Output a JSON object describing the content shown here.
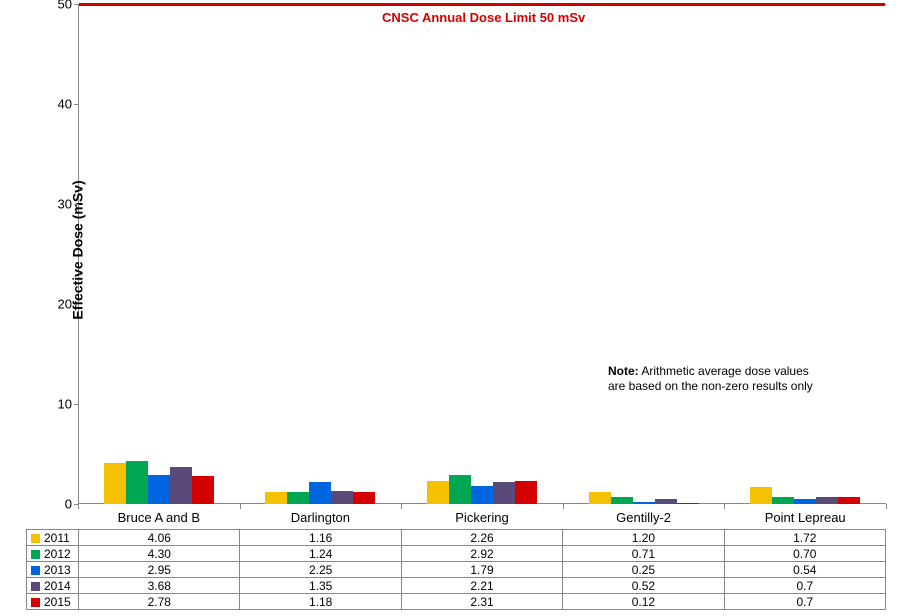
{
  "chart_data": {
    "type": "bar",
    "ylabel": "Effective Dose (mSv)",
    "ylim": [
      0,
      50
    ],
    "yticks": [
      0,
      10,
      20,
      30,
      40,
      50
    ],
    "categories": [
      "Bruce A and B",
      "Darlington",
      "Pickering",
      "Gentilly-2",
      "Point Lepreau"
    ],
    "series": [
      {
        "name": "2011",
        "color": "#f5c000",
        "values": [
          4.06,
          1.16,
          2.26,
          1.2,
          1.72
        ],
        "display": [
          "4.06",
          "1.16",
          "2.26",
          "1.20",
          "1.72"
        ]
      },
      {
        "name": "2012",
        "color": "#00a651",
        "values": [
          4.3,
          1.24,
          2.92,
          0.71,
          0.7
        ],
        "display": [
          "4.30",
          "1.24",
          "2.92",
          "0.71",
          "0.70"
        ]
      },
      {
        "name": "2013",
        "color": "#0066e0",
        "values": [
          2.95,
          2.25,
          1.79,
          0.25,
          0.54
        ],
        "display": [
          "2.95",
          "2.25",
          "1.79",
          "0.25",
          "0.54"
        ]
      },
      {
        "name": "2014",
        "color": "#5a4a7a",
        "values": [
          3.68,
          1.35,
          2.21,
          0.52,
          0.7
        ],
        "display": [
          "3.68",
          "1.35",
          "2.21",
          "0.52",
          "0.7"
        ]
      },
      {
        "name": "2015",
        "color": "#d40000",
        "values": [
          2.78,
          1.18,
          2.31,
          0.12,
          0.7
        ],
        "display": [
          "2.78",
          "1.18",
          "2.31",
          "0.12",
          "0.7"
        ]
      }
    ],
    "limit_line": {
      "value": 50,
      "label": "CNSC Annual Dose Limit 50 mSv"
    },
    "note_bold": "Note:",
    "note_text": " Arithmetic average dose values are based on the non-zero results only"
  }
}
